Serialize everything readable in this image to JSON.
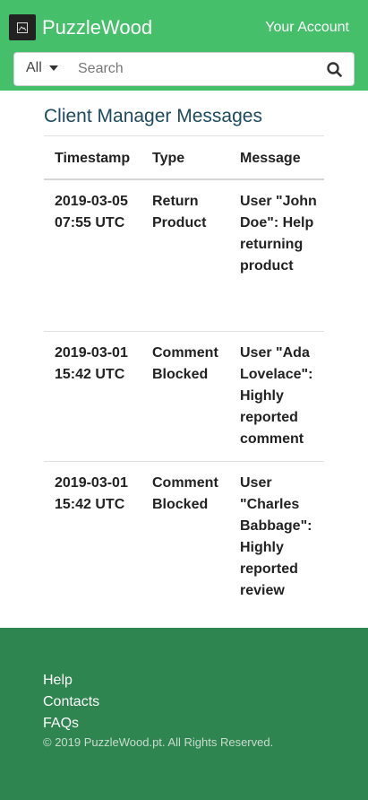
{
  "header": {
    "brand": "PuzzleWood",
    "account": "Your Account",
    "logo_icon": "image-icon"
  },
  "search": {
    "filter": "All",
    "placeholder": "Search",
    "icon": "search-icon"
  },
  "main": {
    "title": "Client Manager Messages",
    "columns": [
      "Timestamp",
      "Type",
      "Message"
    ],
    "rows": [
      {
        "timestamp": "2019-03-05 07:55 UTC",
        "type": "Return Product",
        "message": "User \"John Doe\": Help returning product"
      },
      {
        "timestamp": "2019-03-01 15:42 UTC",
        "type": "Comment Blocked",
        "message": "User \"Ada Lovelace\": Highly reported comment"
      },
      {
        "timestamp": "2019-03-01 15:42 UTC",
        "type": "Comment Blocked",
        "message": "User \"Charles Babbage\": Highly reported review"
      }
    ]
  },
  "footer": {
    "links": [
      "Help",
      "Contacts",
      "FAQs"
    ],
    "copyright": "© 2019 PuzzleWood.pt. All Rights Reserved."
  },
  "colors": {
    "header": "#45bf6a",
    "footer": "#2e8550",
    "title": "#1d4a5e"
  }
}
